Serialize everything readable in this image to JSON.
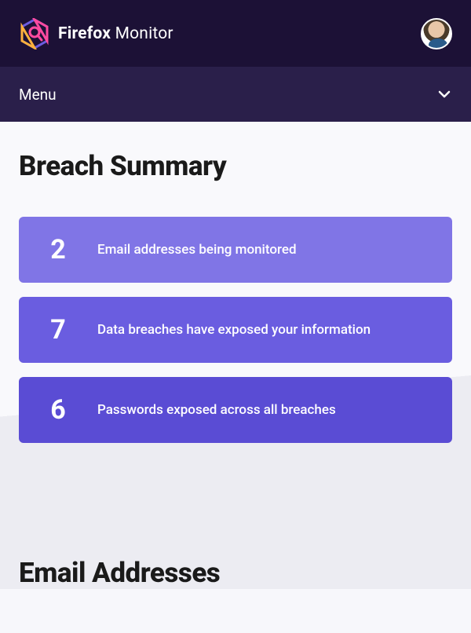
{
  "brand": {
    "name_bold": "Firefox",
    "name_thin": " Monitor"
  },
  "nav": {
    "menu_label": "Menu"
  },
  "summary": {
    "title": "Breach Summary",
    "cards": [
      {
        "num": "2",
        "label": "Email addresses being monitored"
      },
      {
        "num": "7",
        "label": "Data breaches have exposed your information"
      },
      {
        "num": "6",
        "label": "Passwords exposed across all breaches"
      }
    ]
  },
  "emails": {
    "title": "Email Addresses"
  }
}
